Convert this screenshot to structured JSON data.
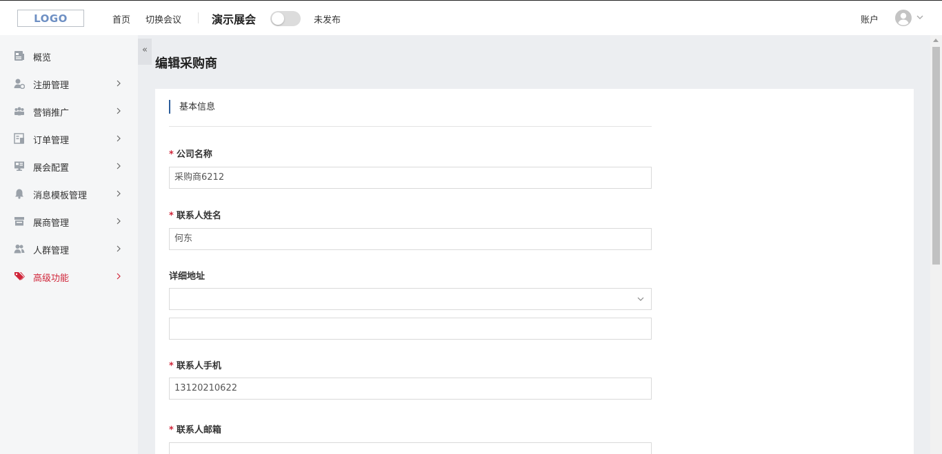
{
  "header": {
    "logo": "LOGO",
    "nav": [
      "首页",
      "切换会议"
    ],
    "event_name": "演示展会",
    "publish_status": "未发布",
    "account": "账户"
  },
  "sidebar": {
    "items": [
      {
        "label": "概览",
        "icon": "overview-icon",
        "has_chevron": false
      },
      {
        "label": "注册管理",
        "icon": "user-register-icon",
        "has_chevron": true
      },
      {
        "label": "营销推广",
        "icon": "people-group-icon",
        "has_chevron": true
      },
      {
        "label": "订单管理",
        "icon": "order-list-icon",
        "has_chevron": true
      },
      {
        "label": "展会配置",
        "icon": "monitor-icon",
        "has_chevron": true
      },
      {
        "label": "消息模板管理",
        "icon": "bell-icon",
        "has_chevron": true
      },
      {
        "label": "展商管理",
        "icon": "store-icon",
        "has_chevron": true
      },
      {
        "label": "人群管理",
        "icon": "crowd-icon",
        "has_chevron": true
      },
      {
        "label": "高级功能",
        "icon": "tags-icon",
        "has_chevron": true,
        "active": true
      }
    ],
    "active_color": "#d0263a"
  },
  "main": {
    "collapse_symbol": "«",
    "page_title": "编辑采购商",
    "section_title": "基本信息",
    "form": {
      "company_name_label": "公司名称",
      "company_name_value": "采购商6212",
      "contact_name_label": "联系人姓名",
      "contact_name_value": "何东",
      "address_label": "详细地址",
      "address_select_value": "",
      "address_detail_value": "",
      "mobile_label": "联系人手机",
      "mobile_value": "13120210622",
      "email_label": "联系人邮箱",
      "email_value": "",
      "required_mark": "*"
    }
  },
  "colors": {
    "accent_blue": "#2b5d9b",
    "required_red": "#d0263a"
  }
}
